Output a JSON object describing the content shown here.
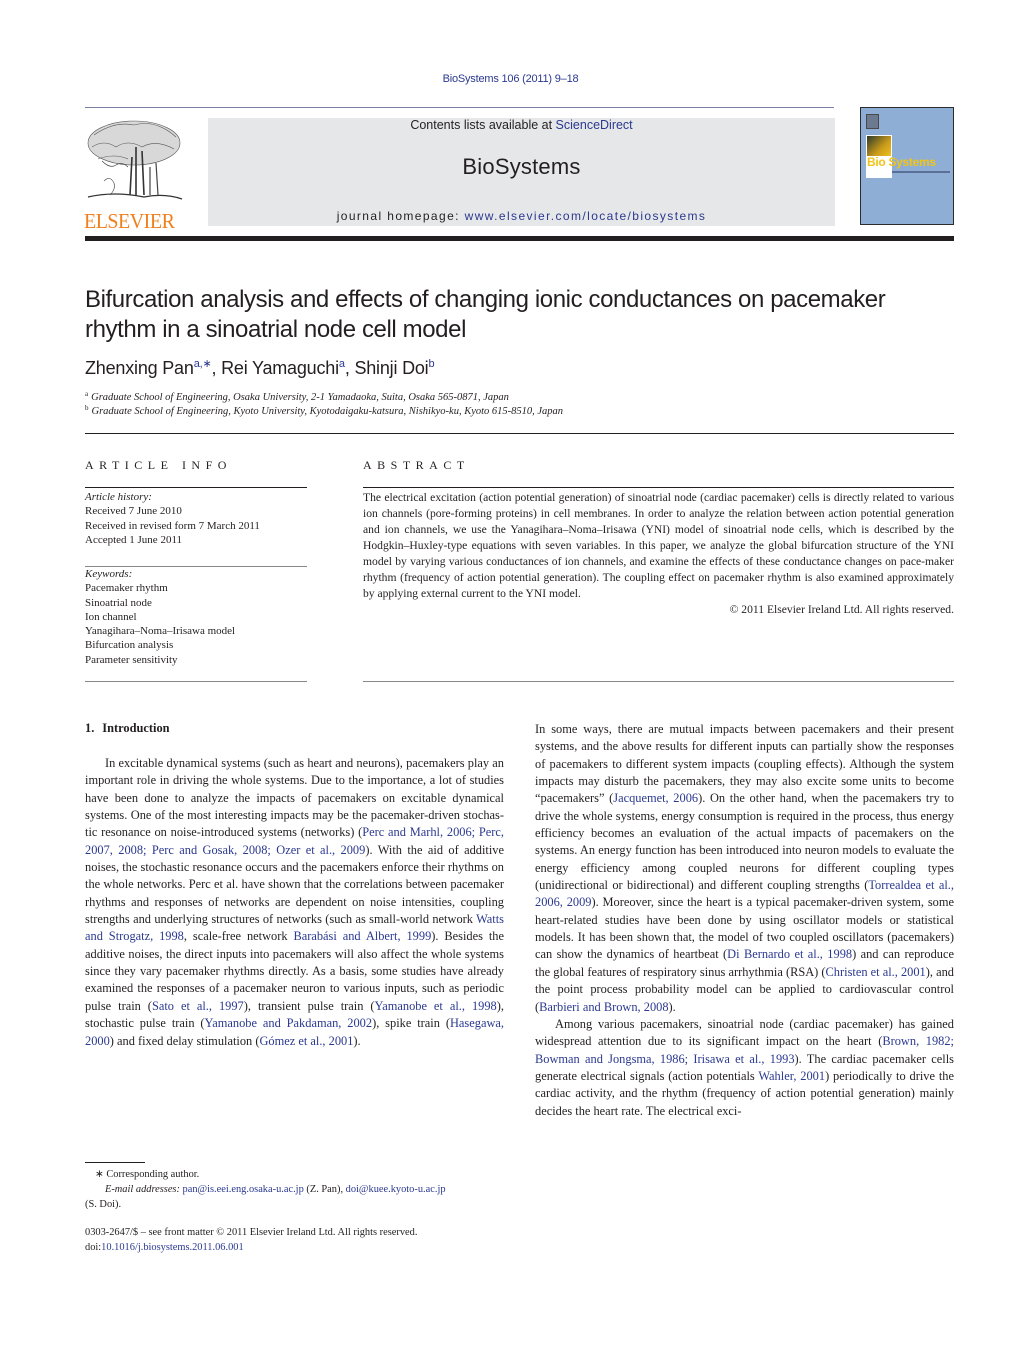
{
  "header": {
    "citation": "BioSystems 106 (2011) 9–18",
    "publisher_wordmark": "ELSEVIER",
    "contents_prefix": "Contents lists available at ",
    "contents_link": "ScienceDirect",
    "journal_title": "BioSystems",
    "homepage_prefix": "journal homepage: ",
    "homepage_link": "www.elsevier.com/locate/biosystems",
    "cover_brand": "Bio Systems"
  },
  "colors": {
    "link": "#2b3990",
    "elsevier_orange": "#f07f1c",
    "masthead_bg": "#e6e7e8",
    "cover_bg": "#8faed6",
    "cover_brand": "#f0c419"
  },
  "article": {
    "title": "Bifurcation analysis and effects of changing ionic conductances on pacemaker rhythm in a sinoatrial node cell model",
    "authors": [
      {
        "name": "Zhenxing Pan",
        "sup": "a,∗"
      },
      {
        "name": "Rei Yamaguchi",
        "sup": "a"
      },
      {
        "name": "Shinji Doi",
        "sup": "b"
      }
    ],
    "affiliations": [
      {
        "mark": "a",
        "text": "Graduate School of Engineering, Osaka University, 2-1 Yamadaoka, Suita, Osaka 565-0871, Japan"
      },
      {
        "mark": "b",
        "text": "Graduate School of Engineering, Kyoto University, Kyotodaigaku-katsura, Nishikyo-ku, Kyoto 615-8510, Japan"
      }
    ]
  },
  "article_info": {
    "heading": "ARTICLE INFO",
    "history_label": "Article history:",
    "history": [
      "Received 7 June 2010",
      "Received in revised form 7 March 2011",
      "Accepted 1 June 2011"
    ],
    "keywords_label": "Keywords:",
    "keywords": [
      "Pacemaker rhythm",
      "Sinoatrial node",
      "Ion channel",
      "Yanagihara–Noma–Irisawa model",
      "Bifurcation analysis",
      "Parameter sensitivity"
    ]
  },
  "abstract": {
    "heading": "ABSTRACT",
    "text": "The electrical excitation (action potential generation) of sinoatrial node (cardiac pacemaker) cells is directly related to various ion channels (pore-forming proteins) in cell membranes. In order to analyze the relation between action potential generation and ion channels, we use the Yanagihara–Noma–Irisawa (YNI) model of sinoatrial node cells, which is described by the Hodgkin–Huxley-type equations with seven variables. In this paper, we analyze the global bifurcation structure of the YNI model by varying various conductances of ion channels, and examine the effects of these conductance changes on pace-maker rhythm (frequency of action potential generation). The coupling effect on pacemaker rhythm is also examined approximately by applying external current to the YNI model.",
    "copyright": "© 2011 Elsevier Ireland Ltd. All rights reserved."
  },
  "body": {
    "section_number": "1.",
    "section_title": "Introduction",
    "left_column": [
      {
        "t": "In excitable dynamical systems (such as heart and neurons), pacemakers play an important role in driving the whole systems. Due to the importance, a lot of studies have been done to analyze the impacts of pacemakers on excitable dynamical systems. One of the most interesting impacts may be the pacemaker-driven stochas­tic resonance on noise-introduced systems (networks) ("
      },
      {
        "t": "Perc and Marhl, 2006; Perc, 2007, 2008; Perc and Gosak, 2008; Ozer et al., 2009",
        "link": true
      },
      {
        "t": "). With the aid of additive noises, the stochastic resonance occurs and the pacemakers enforce their rhythms on the whole networks. Perc et al. have shown that the correlations between pacemaker rhythms and responses of networks are dependent on noise intensities, coupling strengths and underlying structures of networks (such as small-world network "
      },
      {
        "t": "Watts and Strogatz, 1998",
        "link": true
      },
      {
        "t": ", scale-free network "
      },
      {
        "t": "Barabási and Albert, 1999",
        "link": true
      },
      {
        "t": "). Besides the addi­tive noises, the direct inputs into pacemakers will also affect the whole systems since they vary pacemaker rhythms directly. As a basis, some studies have already examined the responses of a pacemaker neuron to various inputs, such as periodic pulse train ("
      },
      {
        "t": "Sato et al., 1997",
        "link": true
      },
      {
        "t": "), transient pulse train ("
      },
      {
        "t": "Yamanobe et al., 1998",
        "link": true
      },
      {
        "t": "), stochastic pulse train ("
      },
      {
        "t": "Yamanobe and Pakdaman, 2002",
        "link": true
      },
      {
        "t": "), spike train ("
      },
      {
        "t": "Hasegawa, 2000",
        "link": true
      },
      {
        "t": ") and fixed delay stimulation ("
      },
      {
        "t": "Gómez et al., 2001",
        "link": true
      },
      {
        "t": ")."
      }
    ],
    "right_column_p1": [
      {
        "t": "In some ways, there are mutual impacts between pacemakers and their present systems, and the above results for different inputs can partially show the responses of pacemakers to different sys­tem impacts (coupling effects). Although the system impacts may disturb the pacemakers, they may also excite some units to become “pacemakers” ("
      },
      {
        "t": "Jacquemet, 2006",
        "link": true
      },
      {
        "t": "). On the other hand, when the pacemakers try to drive the whole systems, energy consumption is required in the process, thus energy efficiency becomes an eval­uation of the actual impacts of pacemakers on the systems. An energy function has been introduced into neuron models to eval­uate the energy efficiency among coupled neurons for different coupling types (unidirectional or bidirectional) and different cou­pling strengths ("
      },
      {
        "t": "Torrealdea et al., 2006, 2009",
        "link": true
      },
      {
        "t": "). Moreover, since the heart is a typical pacemaker-driven system, some heart-related studies have been done by using oscillator models or statistical models. It has been shown that, the model of two coupled oscilla­tors (pacemakers) can show the dynamics of heartbeat ("
      },
      {
        "t": "Di Bernardo et al., 1998",
        "link": true
      },
      {
        "t": ") and can reproduce the global features of respiratory sinus arrhythmia (RSA) ("
      },
      {
        "t": "Christen et al., 2001",
        "link": true
      },
      {
        "t": "), and the point process probability model can be applied to cardiovascular control ("
      },
      {
        "t": "Barbieri and Brown, 2008",
        "link": true
      },
      {
        "t": ")."
      }
    ],
    "right_column_p2": [
      {
        "t": "Among various pacemakers, sinoatrial node (cardiac pace­maker) has gained widespread attention due to its significant impact on the heart ("
      },
      {
        "t": "Brown, 1982; Bowman and Jongsma, 1986; Irisawa et al., 1993",
        "link": true
      },
      {
        "t": "). The cardiac pacemaker cells generate electri­cal signals (action potentials "
      },
      {
        "t": "Wahler, 2001",
        "link": true
      },
      {
        "t": ") periodically to drive the cardiac activity, and the rhythm (frequency of action potential generation) mainly decides the heart rate. The electrical exci-"
      }
    ]
  },
  "footnote": {
    "mark": "∗",
    "corresponding": "Corresponding author.",
    "email_label": "E-mail addresses:",
    "email1": "pan@is.eei.eng.osaka-u.ac.jp",
    "email1_name": "(Z. Pan),",
    "email2": "doi@kuee.kyoto-u.ac.jp",
    "email2_name": "(S. Doi)."
  },
  "front_matter": {
    "issn_line": "0303-2647/$ – see front matter © 2011 Elsevier Ireland Ltd. All rights reserved.",
    "doi_prefix": "doi:",
    "doi": "10.1016/j.biosystems.2011.06.001"
  }
}
